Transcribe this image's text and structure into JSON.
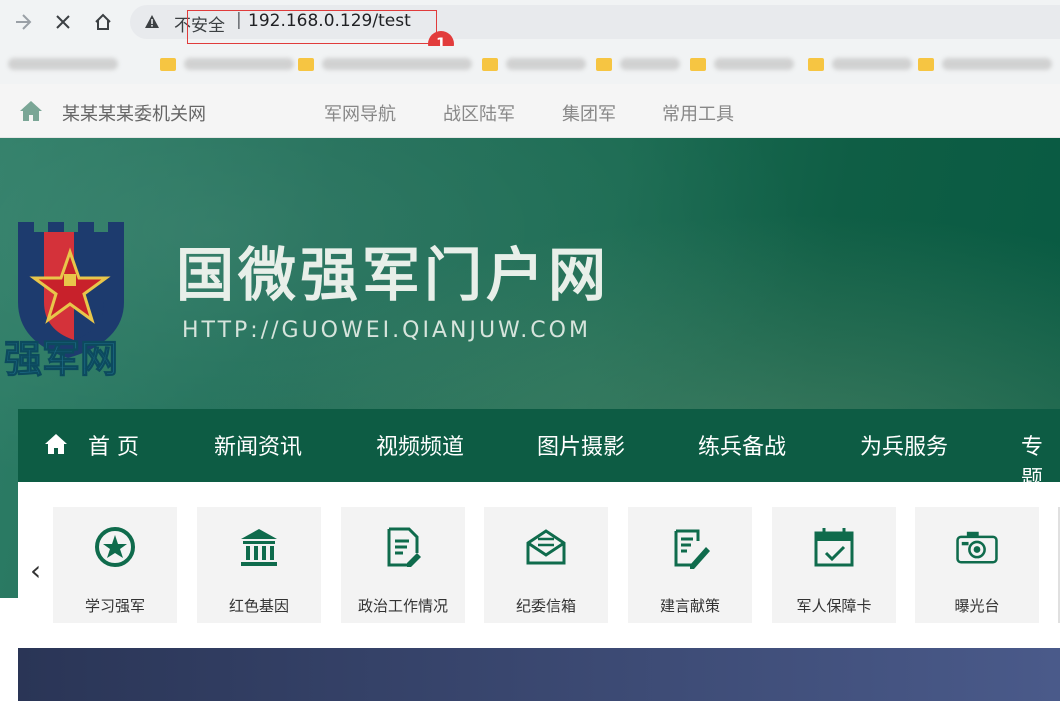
{
  "browser": {
    "insecure_label": "不安全",
    "separator": "|",
    "url": "192.168.0.129/test",
    "marker_number": "1"
  },
  "site": {
    "title": "某某某某委机关网",
    "top_links": [
      "军网导航",
      "战区陆军",
      "集团军",
      "常用工具"
    ]
  },
  "banner": {
    "brand": "国微强军门户网",
    "brand_url": "HTTP://GUOWEI.QIANJUW.COM",
    "logo_text": "强军网"
  },
  "mainnav": {
    "items": [
      "首 页",
      "新闻资讯",
      "视频频道",
      "图片摄影",
      "练兵备战",
      "为兵服务",
      "专题"
    ]
  },
  "quicklinks": {
    "items": [
      "学习强军",
      "红色基因",
      "政治工作情况",
      "纪委信箱",
      "建言献策",
      "军人保障卡",
      "曝光台"
    ]
  },
  "colors": {
    "nav_green": "#0d5c44",
    "icon_green": "#0f6b4c",
    "marker_red": "#e23c3c"
  }
}
